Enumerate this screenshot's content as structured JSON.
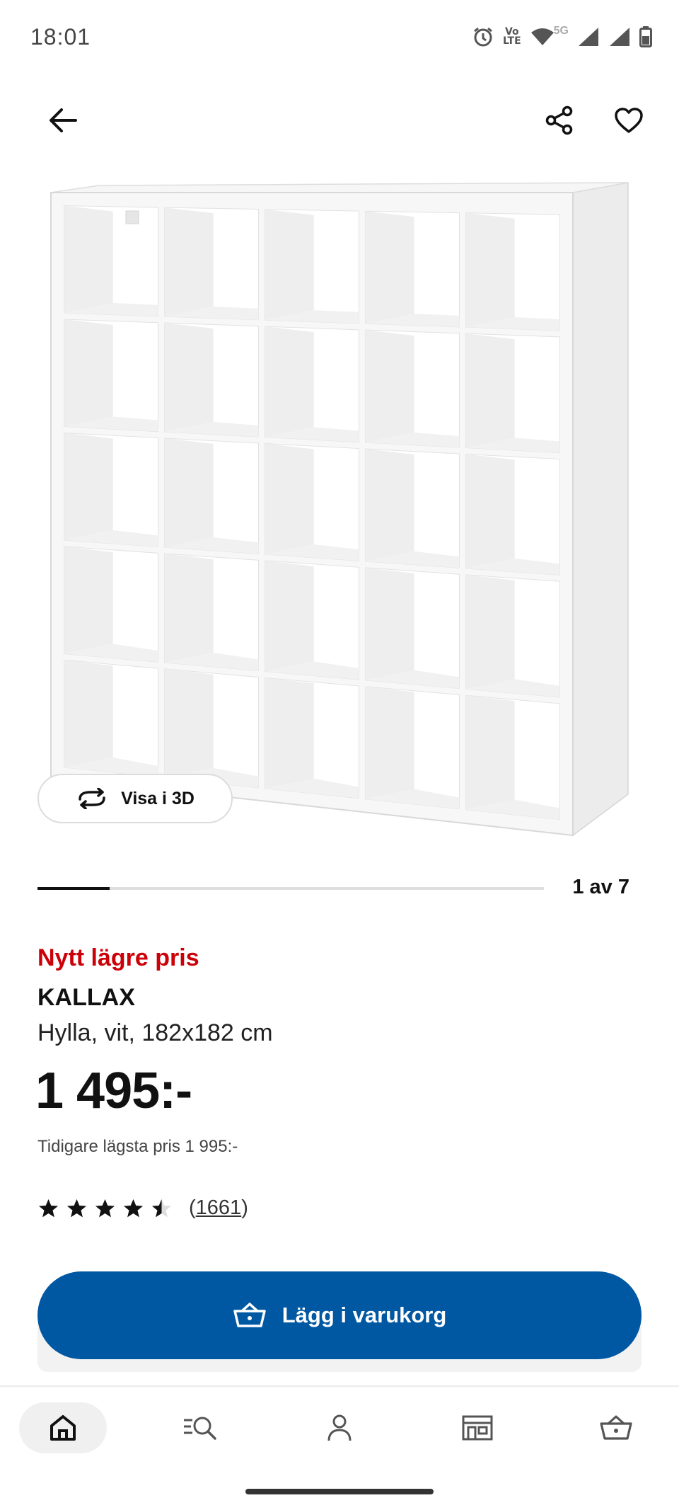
{
  "status_bar": {
    "time": "18:01",
    "volte_top": "Vo",
    "volte_bottom": "LTE",
    "network": "5G",
    "icons": [
      "alarm-icon",
      "volte-icon",
      "wifi-icon",
      "signal-icon",
      "signal-icon",
      "battery-icon"
    ]
  },
  "top_nav": {
    "icons": [
      "back-arrow-icon",
      "share-icon",
      "heart-icon"
    ]
  },
  "product_image": {
    "icon": "shelf-unit-image",
    "view_3d_label": "Visa i 3D"
  },
  "carousel": {
    "counter": "1 av 7",
    "current": 1,
    "total": 7
  },
  "product": {
    "promo_label": "Nytt lägre pris",
    "name": "KALLAX",
    "description": "Hylla, vit, 182x182 cm",
    "price": "1 495:-",
    "previous_lowest_price": "Tidigare lägsta pris 1 995:-",
    "rating": 4.5,
    "rating_max": 5,
    "review_count_open": "(",
    "review_count": "1661",
    "review_count_close": ")"
  },
  "cart_button": {
    "label": "Lägg i varukorg",
    "icon": "basket-icon"
  },
  "bottom_nav": {
    "items": [
      "home-icon",
      "search-icon",
      "account-icon",
      "stores-icon",
      "cart-icon"
    ],
    "active": "home-icon"
  },
  "colors": {
    "accent_blue": "#0058a3",
    "promo_red": "#cc0008",
    "text": "#111111"
  }
}
